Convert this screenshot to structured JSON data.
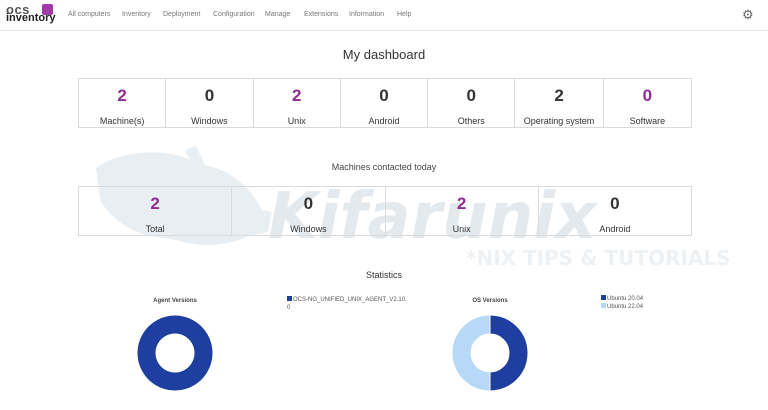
{
  "app": {
    "logo_top": "ocs",
    "logo_bottom": "inventory"
  },
  "nav": {
    "items": [
      {
        "label": "All computers"
      },
      {
        "label": "Inventory"
      },
      {
        "label": "Deployment"
      },
      {
        "label": "Configuration"
      },
      {
        "label": "Manage"
      },
      {
        "label": "Extensions"
      },
      {
        "label": "Information"
      },
      {
        "label": "Help"
      }
    ],
    "settings_icon": "gear-icon"
  },
  "dashboard": {
    "title": "My dashboard",
    "cards": [
      {
        "value": "2",
        "label": "Machine(s)",
        "color": "#8e2c94"
      },
      {
        "value": "0",
        "label": "Windows",
        "color": "#333333"
      },
      {
        "value": "2",
        "label": "Unix",
        "color": "#8e2c94"
      },
      {
        "value": "0",
        "label": "Android",
        "color": "#333333"
      },
      {
        "value": "0",
        "label": "Others",
        "color": "#333333"
      },
      {
        "value": "2",
        "label": "Operating system",
        "color": "#333333"
      },
      {
        "value": "0",
        "label": "Software",
        "color": "#8e2c94"
      }
    ]
  },
  "contacted": {
    "title": "Machines contacted today",
    "cards": [
      {
        "value": "2",
        "label": "Total",
        "color": "#8e2c94"
      },
      {
        "value": "0",
        "label": "Windows",
        "color": "#333333"
      },
      {
        "value": "2",
        "label": "Unix",
        "color": "#8e2c94"
      },
      {
        "value": "0",
        "label": "Android",
        "color": "#333333"
      }
    ]
  },
  "statistics": {
    "title": "Statistics",
    "agent": {
      "title": "Agent Versions",
      "legend": [
        {
          "label": "OCS-NG_UNIFIED_UNIX_AGENT_V2.10.0",
          "color": "#1e3fa0"
        }
      ]
    },
    "os": {
      "title": "OS Versions",
      "legend": [
        {
          "label": "Ubuntu 20.04",
          "color": "#1e3fa0"
        },
        {
          "label": "Ubuntu 22.04",
          "color": "#b6d9f7"
        }
      ]
    }
  },
  "watermark": {
    "brand": "Kifarunix",
    "tagline": "*NIX TIPS & TUTORIALS"
  },
  "chart_data": [
    {
      "type": "pie",
      "title": "Agent Versions",
      "categories": [
        "OCS-NG_UNIFIED_UNIX_AGENT_V2.10.0"
      ],
      "values": [
        2
      ],
      "colors": [
        "#1e3fa0"
      ]
    },
    {
      "type": "pie",
      "title": "OS Versions",
      "categories": [
        "Ubuntu 20.04",
        "Ubuntu 22.04"
      ],
      "values": [
        1,
        1
      ],
      "colors": [
        "#1e3fa0",
        "#b6d9f7"
      ]
    }
  ]
}
